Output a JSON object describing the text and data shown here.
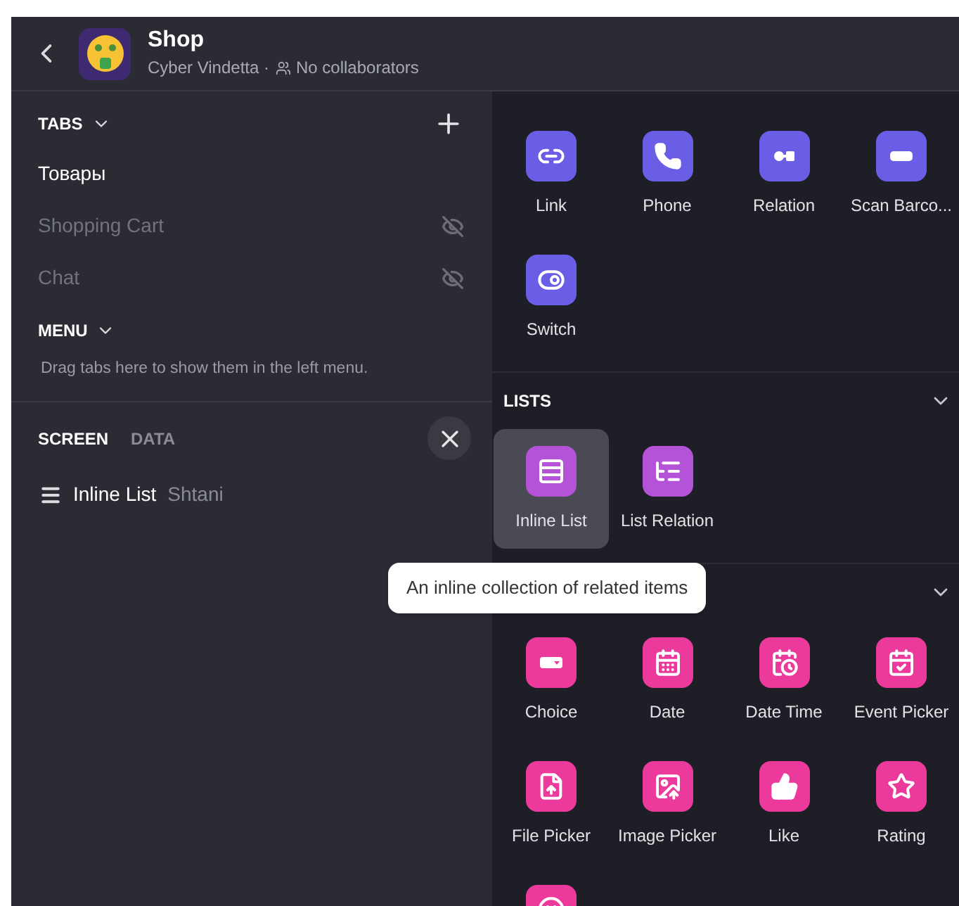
{
  "header": {
    "title": "Shop",
    "owner": "Cyber Vindetta ·",
    "collaborators": "No collaborators"
  },
  "sidebar": {
    "tabs_heading": "TABS",
    "tabs": [
      {
        "label": "Товары",
        "hidden": false
      },
      {
        "label": "Shopping Cart",
        "hidden": true
      },
      {
        "label": "Chat",
        "hidden": true
      }
    ],
    "menu_heading": "MENU",
    "menu_hint": "Drag tabs here to show them in the left menu.",
    "panel_tabs": [
      {
        "label": "SCREEN",
        "selected": true
      },
      {
        "label": "DATA",
        "selected": false
      }
    ],
    "component": {
      "name": "Inline List",
      "source": "Shtani"
    }
  },
  "sections": [
    {
      "color": "#6b5ee6",
      "items": [
        {
          "kind": "link",
          "label": "Link",
          "selected": false
        },
        {
          "kind": "phone",
          "label": "Phone",
          "selected": false
        },
        {
          "kind": "relation",
          "label": "Relation",
          "selected": false
        },
        {
          "kind": "barcode",
          "label": "Scan Barco...",
          "selected": false
        },
        {
          "kind": "switch",
          "label": "Switch",
          "selected": false
        }
      ]
    },
    {
      "heading": "LISTS",
      "color": "#b452d8",
      "expanded": true,
      "items": [
        {
          "kind": "inline-list",
          "label": "Inline List",
          "selected": true
        },
        {
          "kind": "list-relation",
          "label": "List Relation",
          "selected": false
        }
      ]
    },
    {
      "color": "#ec3a9c",
      "expanded": true,
      "items": [
        {
          "kind": "choice",
          "label": "Choice",
          "selected": false
        },
        {
          "kind": "date",
          "label": "Date",
          "selected": false
        },
        {
          "kind": "datetime",
          "label": "Date Time",
          "selected": false
        },
        {
          "kind": "event",
          "label": "Event Picker",
          "selected": false
        },
        {
          "kind": "file",
          "label": "File Picker",
          "selected": false
        },
        {
          "kind": "image",
          "label": "Image Picker",
          "selected": false
        },
        {
          "kind": "like",
          "label": "Like",
          "selected": false
        },
        {
          "kind": "rating",
          "label": "Rating",
          "selected": false
        },
        {
          "kind": "smile",
          "selected": false
        }
      ]
    }
  ],
  "tooltip": "An inline collection of related items"
}
